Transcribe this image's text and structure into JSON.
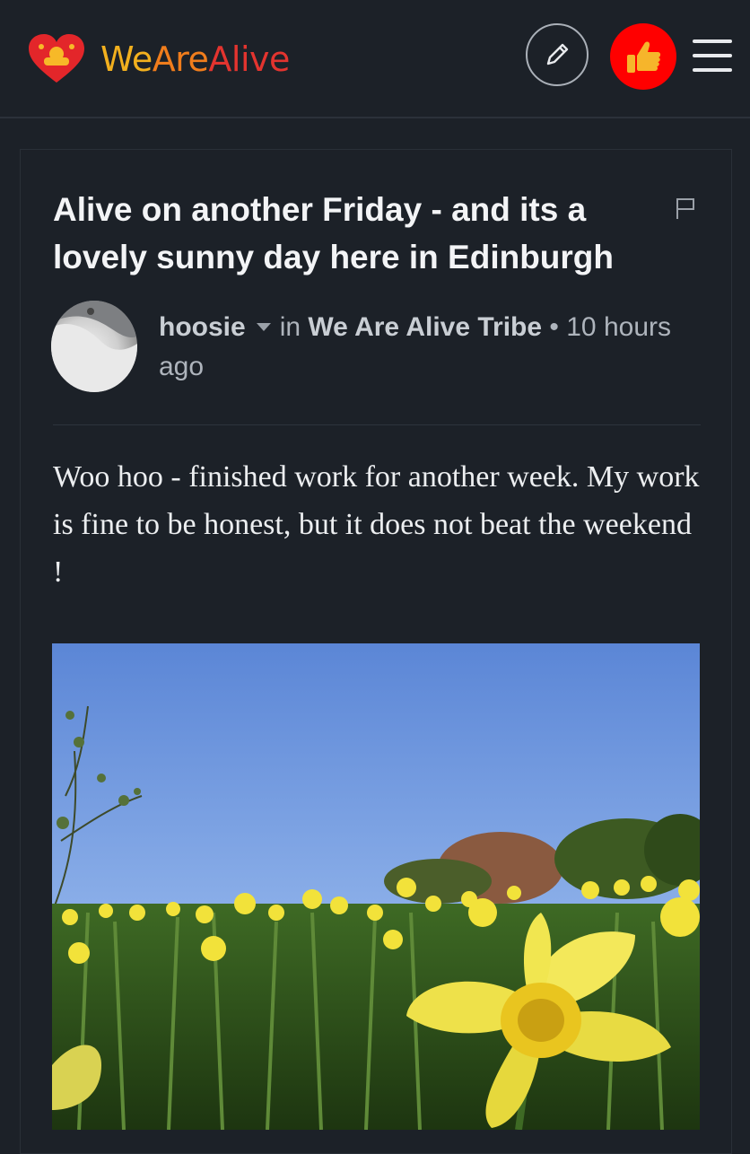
{
  "header": {
    "brand_part1": "We",
    "brand_part2": "Are",
    "brand_part3": "Alive",
    "icons": [
      "heart-logo-icon",
      "pencil-icon",
      "thumbs-up-icon",
      "hamburger-menu-icon"
    ]
  },
  "post": {
    "title": "Alive on another Friday - and its a lovely sunny day here in Edinburgh",
    "author": "hoosie",
    "in_label": "in",
    "community": "We Are Alive Tribe",
    "separator": "•",
    "time": "10 hours ago",
    "body": "Woo hoo - finished work for another week. My work is fine to be honest, but it does not beat the weekend !"
  },
  "colors": {
    "background": "#1c2128",
    "like_button": "#ff0000",
    "brand_yellow": "#f2b01e",
    "brand_orange": "#f07d1c",
    "brand_red": "#e3342f"
  }
}
